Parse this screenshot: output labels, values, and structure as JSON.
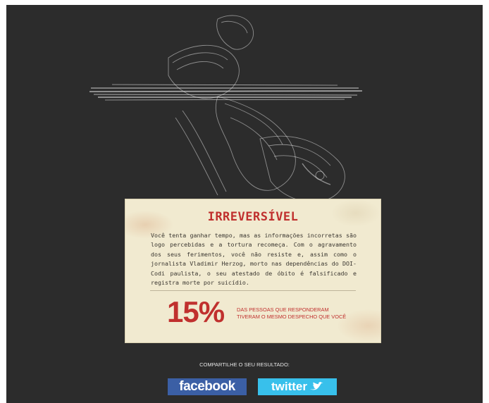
{
  "result": {
    "title": "IRREVERSÍVEL",
    "body": "Você tenta ganhar tempo, mas as informações incorretas são logo percebidas e a tortura recomeça. Com o agravamento dos seus ferimentos, você não resiste e, assim como o jornalista Vladimir Herzog, morto nas dependências do DOI-Codi paulista, o seu atestado de óbito é falsificado e registra morte por suicídio.",
    "stat_percent": "15%",
    "stat_caption_line1": "DAS PESSOAS QUE RESPONDERAM",
    "stat_caption_line2": "TIVERAM O MESMO DESPECHO QUE VOCÊ"
  },
  "share": {
    "label": "COMPARTILHE O SEU RESULTADO:",
    "facebook_label": "facebook",
    "twitter_label": "twitter",
    "twitter_icon": "bird-icon"
  },
  "colors": {
    "background": "#2c2c2c",
    "card": "#f1ead0",
    "accent": "#c0302e",
    "facebook": "#3b5fa5",
    "twitter": "#38c0eb"
  }
}
